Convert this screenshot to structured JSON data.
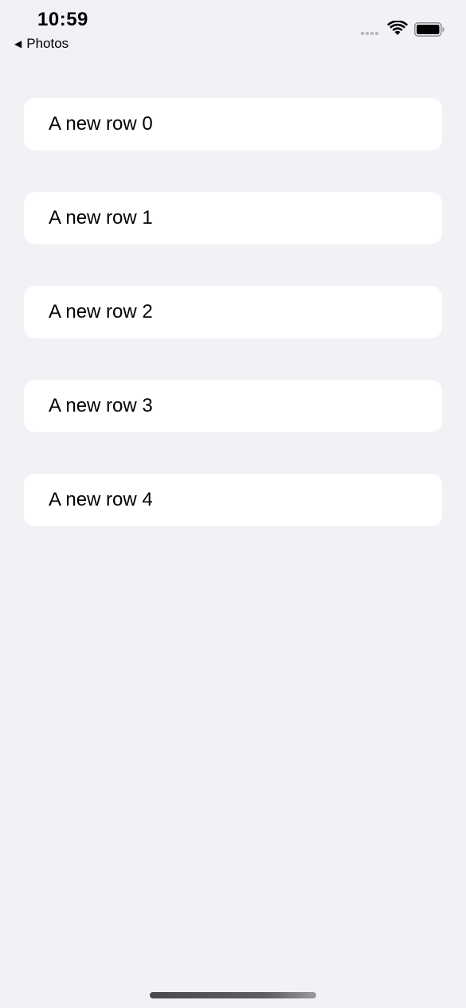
{
  "status_bar": {
    "time": "10:59",
    "back_label": "Photos",
    "icons": [
      "signal-icon",
      "wifi-icon",
      "battery-icon"
    ]
  },
  "list": {
    "rows": [
      {
        "label": "A new row 0"
      },
      {
        "label": "A new row 1"
      },
      {
        "label": "A new row 2"
      },
      {
        "label": "A new row 3"
      },
      {
        "label": "A new row 4"
      }
    ]
  },
  "colors": {
    "background": "#f1f1f6",
    "row_background": "#ffffff",
    "text": "#000000"
  }
}
